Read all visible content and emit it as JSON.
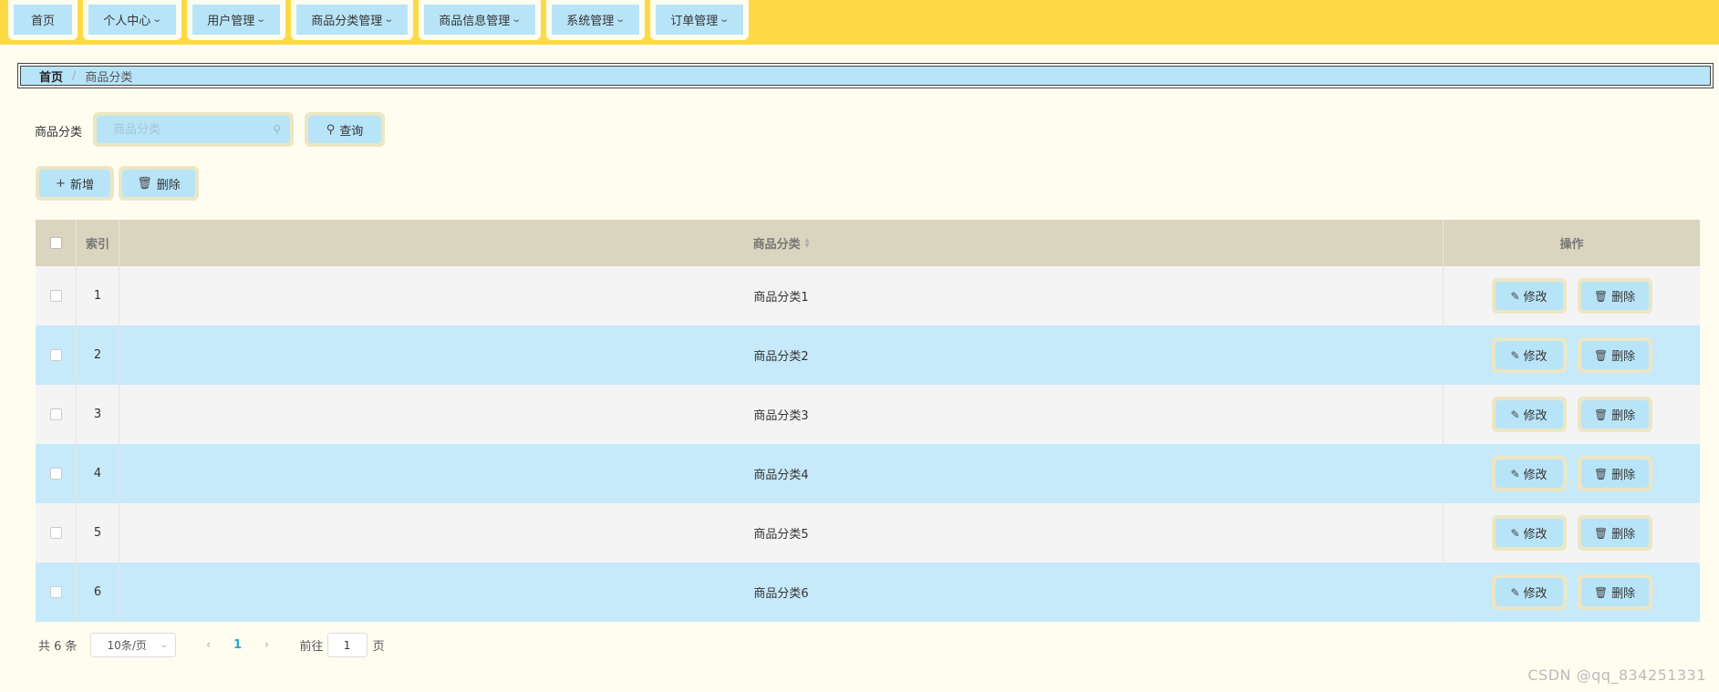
{
  "nav": {
    "items": [
      {
        "label": "首页",
        "dropdown": false
      },
      {
        "label": "个人中心",
        "dropdown": true
      },
      {
        "label": "用户管理",
        "dropdown": true
      },
      {
        "label": "商品分类管理",
        "dropdown": true
      },
      {
        "label": "商品信息管理",
        "dropdown": true
      },
      {
        "label": "系统管理",
        "dropdown": true
      },
      {
        "label": "订单管理",
        "dropdown": true
      }
    ]
  },
  "breadcrumb": {
    "home": "首页",
    "separator": "/",
    "current": "商品分类"
  },
  "search": {
    "label": "商品分类",
    "placeholder": "商品分类",
    "value": "",
    "query_button": "查询"
  },
  "toolbar": {
    "add_button": "新增",
    "delete_button": "删除"
  },
  "table": {
    "headers": {
      "index": "索引",
      "name": "商品分类",
      "actions": "操作"
    },
    "rows": [
      {
        "index": "1",
        "name": "商品分类1"
      },
      {
        "index": "2",
        "name": "商品分类2"
      },
      {
        "index": "3",
        "name": "商品分类3"
      },
      {
        "index": "4",
        "name": "商品分类4"
      },
      {
        "index": "5",
        "name": "商品分类5"
      },
      {
        "index": "6",
        "name": "商品分类6"
      }
    ],
    "row_actions": {
      "edit": "修改",
      "delete": "删除"
    }
  },
  "pagination": {
    "total": "共 6 条",
    "page_size": "10条/页",
    "current_page": "1",
    "goto_prefix": "前往",
    "goto_value": "1",
    "goto_suffix": "页"
  },
  "watermark": "CSDN @qq_834251331",
  "colors": {
    "nav_bg": "#ffd944",
    "page_bg": "#fffdf0",
    "button_fill": "#b8e4f8",
    "button_border": "#ece6c4",
    "table_header": "#dad5be",
    "row_alt": "#c6eafa",
    "active_page": "#2aa7c9"
  }
}
